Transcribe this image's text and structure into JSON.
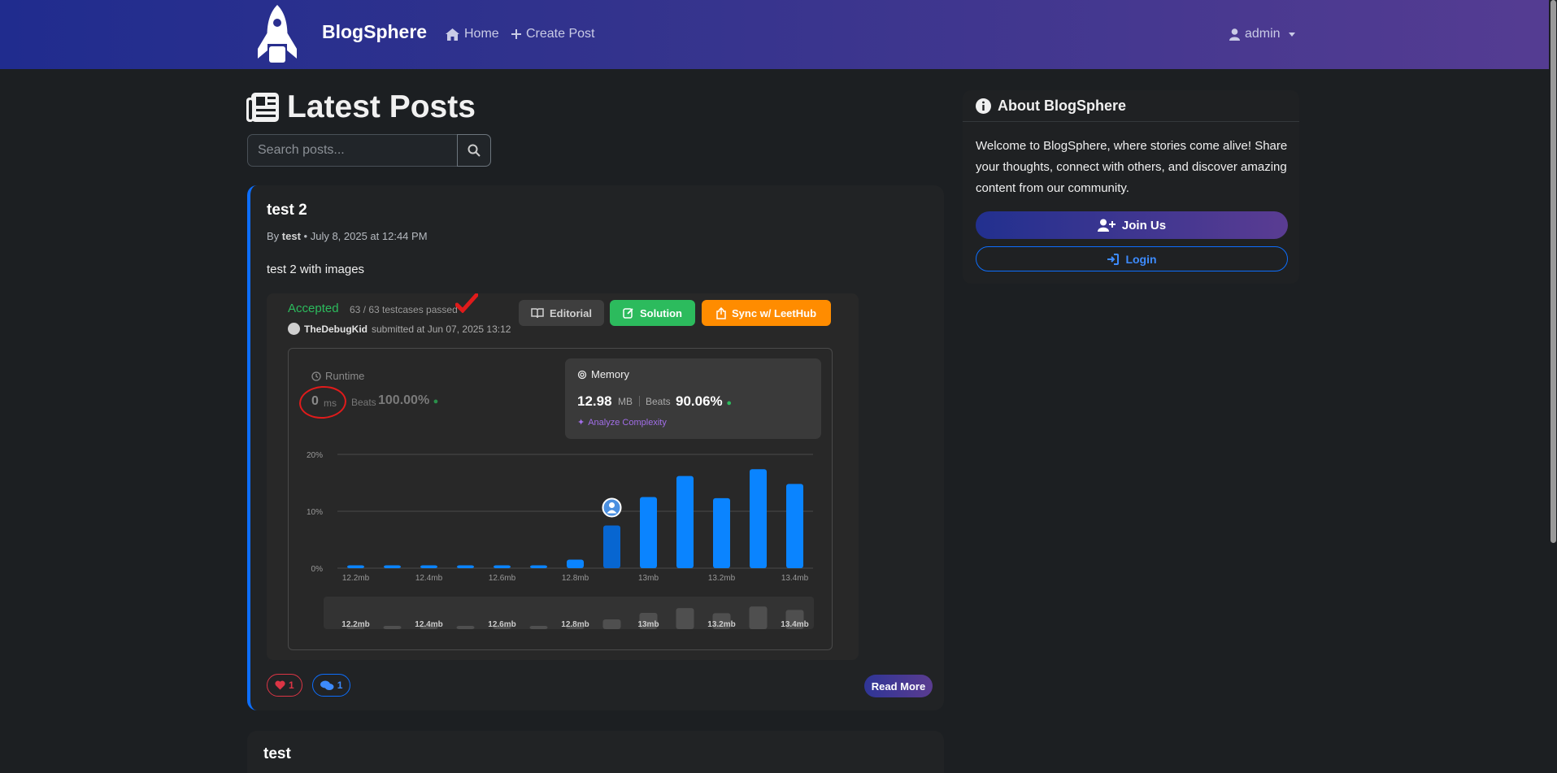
{
  "nav": {
    "brand": "BlogSphere",
    "home": "Home",
    "create": "Create Post",
    "user": "admin"
  },
  "page": {
    "title": "Latest Posts",
    "search_placeholder": "Search posts..."
  },
  "post1": {
    "title": "test 2",
    "by": "By",
    "author": "test",
    "date": "• July 8, 2025 at 12:44 PM",
    "body": "test 2 with images",
    "likes": "1",
    "comments": "1",
    "read_more": "Read More",
    "leetcode": {
      "status": "Accepted",
      "tests": "63 / 63 testcases passed",
      "username": "TheDebugKid",
      "submitted": "submitted at Jun 07, 2025 13:12",
      "editorial": "Editorial",
      "solution": "Solution",
      "leethub": "Sync w/ LeetHub",
      "runtime_label": "Runtime",
      "runtime_value": "0",
      "runtime_unit": "ms",
      "runtime_beats_label": "Beats",
      "runtime_beats": "100.00%",
      "memory_label": "Memory",
      "memory_value": "12.98",
      "memory_unit": "MB",
      "memory_beats_label": "Beats",
      "memory_beats": "90.06%",
      "analyze": "Analyze Complexity"
    }
  },
  "post2": {
    "title": "test"
  },
  "about": {
    "title": "About BlogSphere",
    "text": "Welcome to BlogSphere, where stories come alive! Share your thoughts, connect with others, and discover amazing content from our community.",
    "join": "Join Us",
    "login": "Login"
  },
  "colors": {
    "accent": "#0d6efd",
    "accepted": "#2cbb5d",
    "leethub": "#ff8c00",
    "bar": "#0a84ff",
    "bar_dark": "#0766d1"
  },
  "chart_data": {
    "type": "bar",
    "y_ticks": [
      "20%",
      "10%",
      "0%"
    ],
    "ylim": [
      0,
      20
    ],
    "x_tick_labels": [
      "12.2mb",
      "12.4mb",
      "12.6mb",
      "12.8mb",
      "13mb",
      "13.2mb",
      "13.4mb"
    ],
    "values": [
      0.5,
      0.5,
      0.5,
      0.5,
      0.5,
      0.5,
      1.5,
      7.5,
      12.5,
      16.2,
      12.3,
      17.4,
      14.8
    ],
    "highlight_index": 7,
    "minimap_labels": [
      "12.2mb",
      "12.4mb",
      "12.6mb",
      "12.8mb",
      "13mb",
      "13.2mb",
      "13.4mb"
    ]
  }
}
